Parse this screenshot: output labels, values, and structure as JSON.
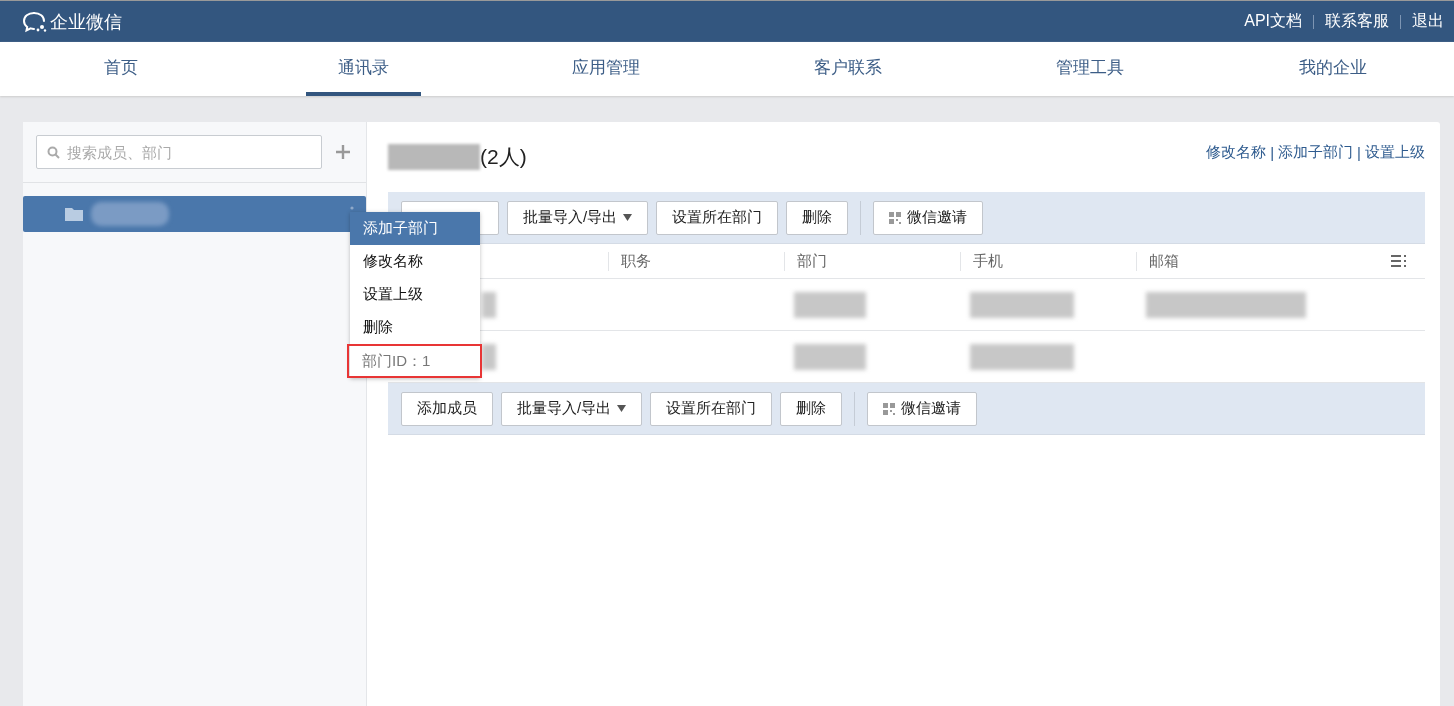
{
  "topbar": {
    "logo": "企业微信",
    "links": [
      "API文档",
      "联系客服",
      "退出"
    ]
  },
  "nav": [
    {
      "label": "首页",
      "selected": false
    },
    {
      "label": "通讯录",
      "selected": true
    },
    {
      "label": "应用管理",
      "selected": false
    },
    {
      "label": "客户联系",
      "selected": false
    },
    {
      "label": "管理工具",
      "selected": false
    },
    {
      "label": "我的企业",
      "selected": false
    }
  ],
  "sidebar": {
    "search": {
      "placeholder": "搜索成员、部门"
    },
    "tree": [
      {
        "selected": true
      }
    ]
  },
  "context_menu": [
    {
      "label": "添加子部门",
      "selected": true,
      "kind": "action"
    },
    {
      "label": "修改名称",
      "selected": false,
      "kind": "action"
    },
    {
      "label": "设置上级",
      "selected": false,
      "kind": "action"
    },
    {
      "label": "删除",
      "selected": false,
      "kind": "action"
    },
    {
      "label": "部门ID：1",
      "kind": "info"
    }
  ],
  "department": {
    "count": "(2人)",
    "links": [
      "修改名称",
      "添加子部门",
      "设置上级"
    ],
    "separator": "|"
  },
  "toolbar_top": [
    {
      "kind": "covered"
    },
    {
      "label": "批量导入/导出",
      "kind": "dropdown"
    },
    {
      "label": "设置所在部门",
      "kind": "plain"
    },
    {
      "label": "删除",
      "kind": "plain"
    },
    {
      "label": "微信邀请",
      "kind": "icon"
    }
  ],
  "table": {
    "columns": [
      "职务",
      "部门",
      "手机",
      "邮箱"
    ],
    "rows": [
      {
        "blurred": [
          true,
          false,
          true,
          true,
          true
        ]
      },
      {
        "blurred": [
          true,
          false,
          true,
          true,
          false
        ]
      }
    ]
  },
  "toolbar_bottom": [
    {
      "label": "添加成员",
      "kind": "plain"
    },
    {
      "label": "批量导入/导出",
      "kind": "dropdown"
    },
    {
      "label": "设置所在部门",
      "kind": "plain"
    },
    {
      "label": "删除",
      "kind": "plain"
    },
    {
      "label": "微信邀请",
      "kind": "icon"
    }
  ]
}
